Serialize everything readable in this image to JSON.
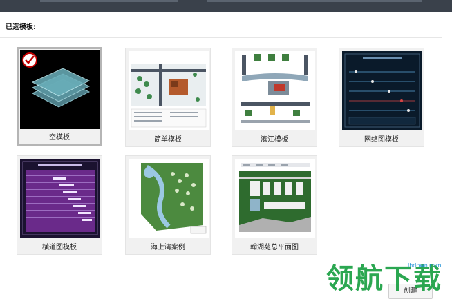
{
  "section": {
    "label": "已选模板:"
  },
  "templates": [
    {
      "name": "空模板",
      "selected": true
    },
    {
      "name": "简单模板",
      "selected": false
    },
    {
      "name": "滨江模板",
      "selected": false
    },
    {
      "name": "网络图模板",
      "selected": false
    },
    {
      "name": "横道图模板",
      "selected": false
    },
    {
      "name": "海上湾案例",
      "selected": false
    },
    {
      "name": "翰湖苑总平面图",
      "selected": false
    }
  ],
  "actions": {
    "create_label": "创建"
  },
  "watermark": {
    "text": "领航下载",
    "url": "lhdown.com"
  },
  "colors": {
    "accent_check": "#c40000",
    "watermark_green": "#1aa043",
    "watermark_blue": "#1d8fd6"
  }
}
